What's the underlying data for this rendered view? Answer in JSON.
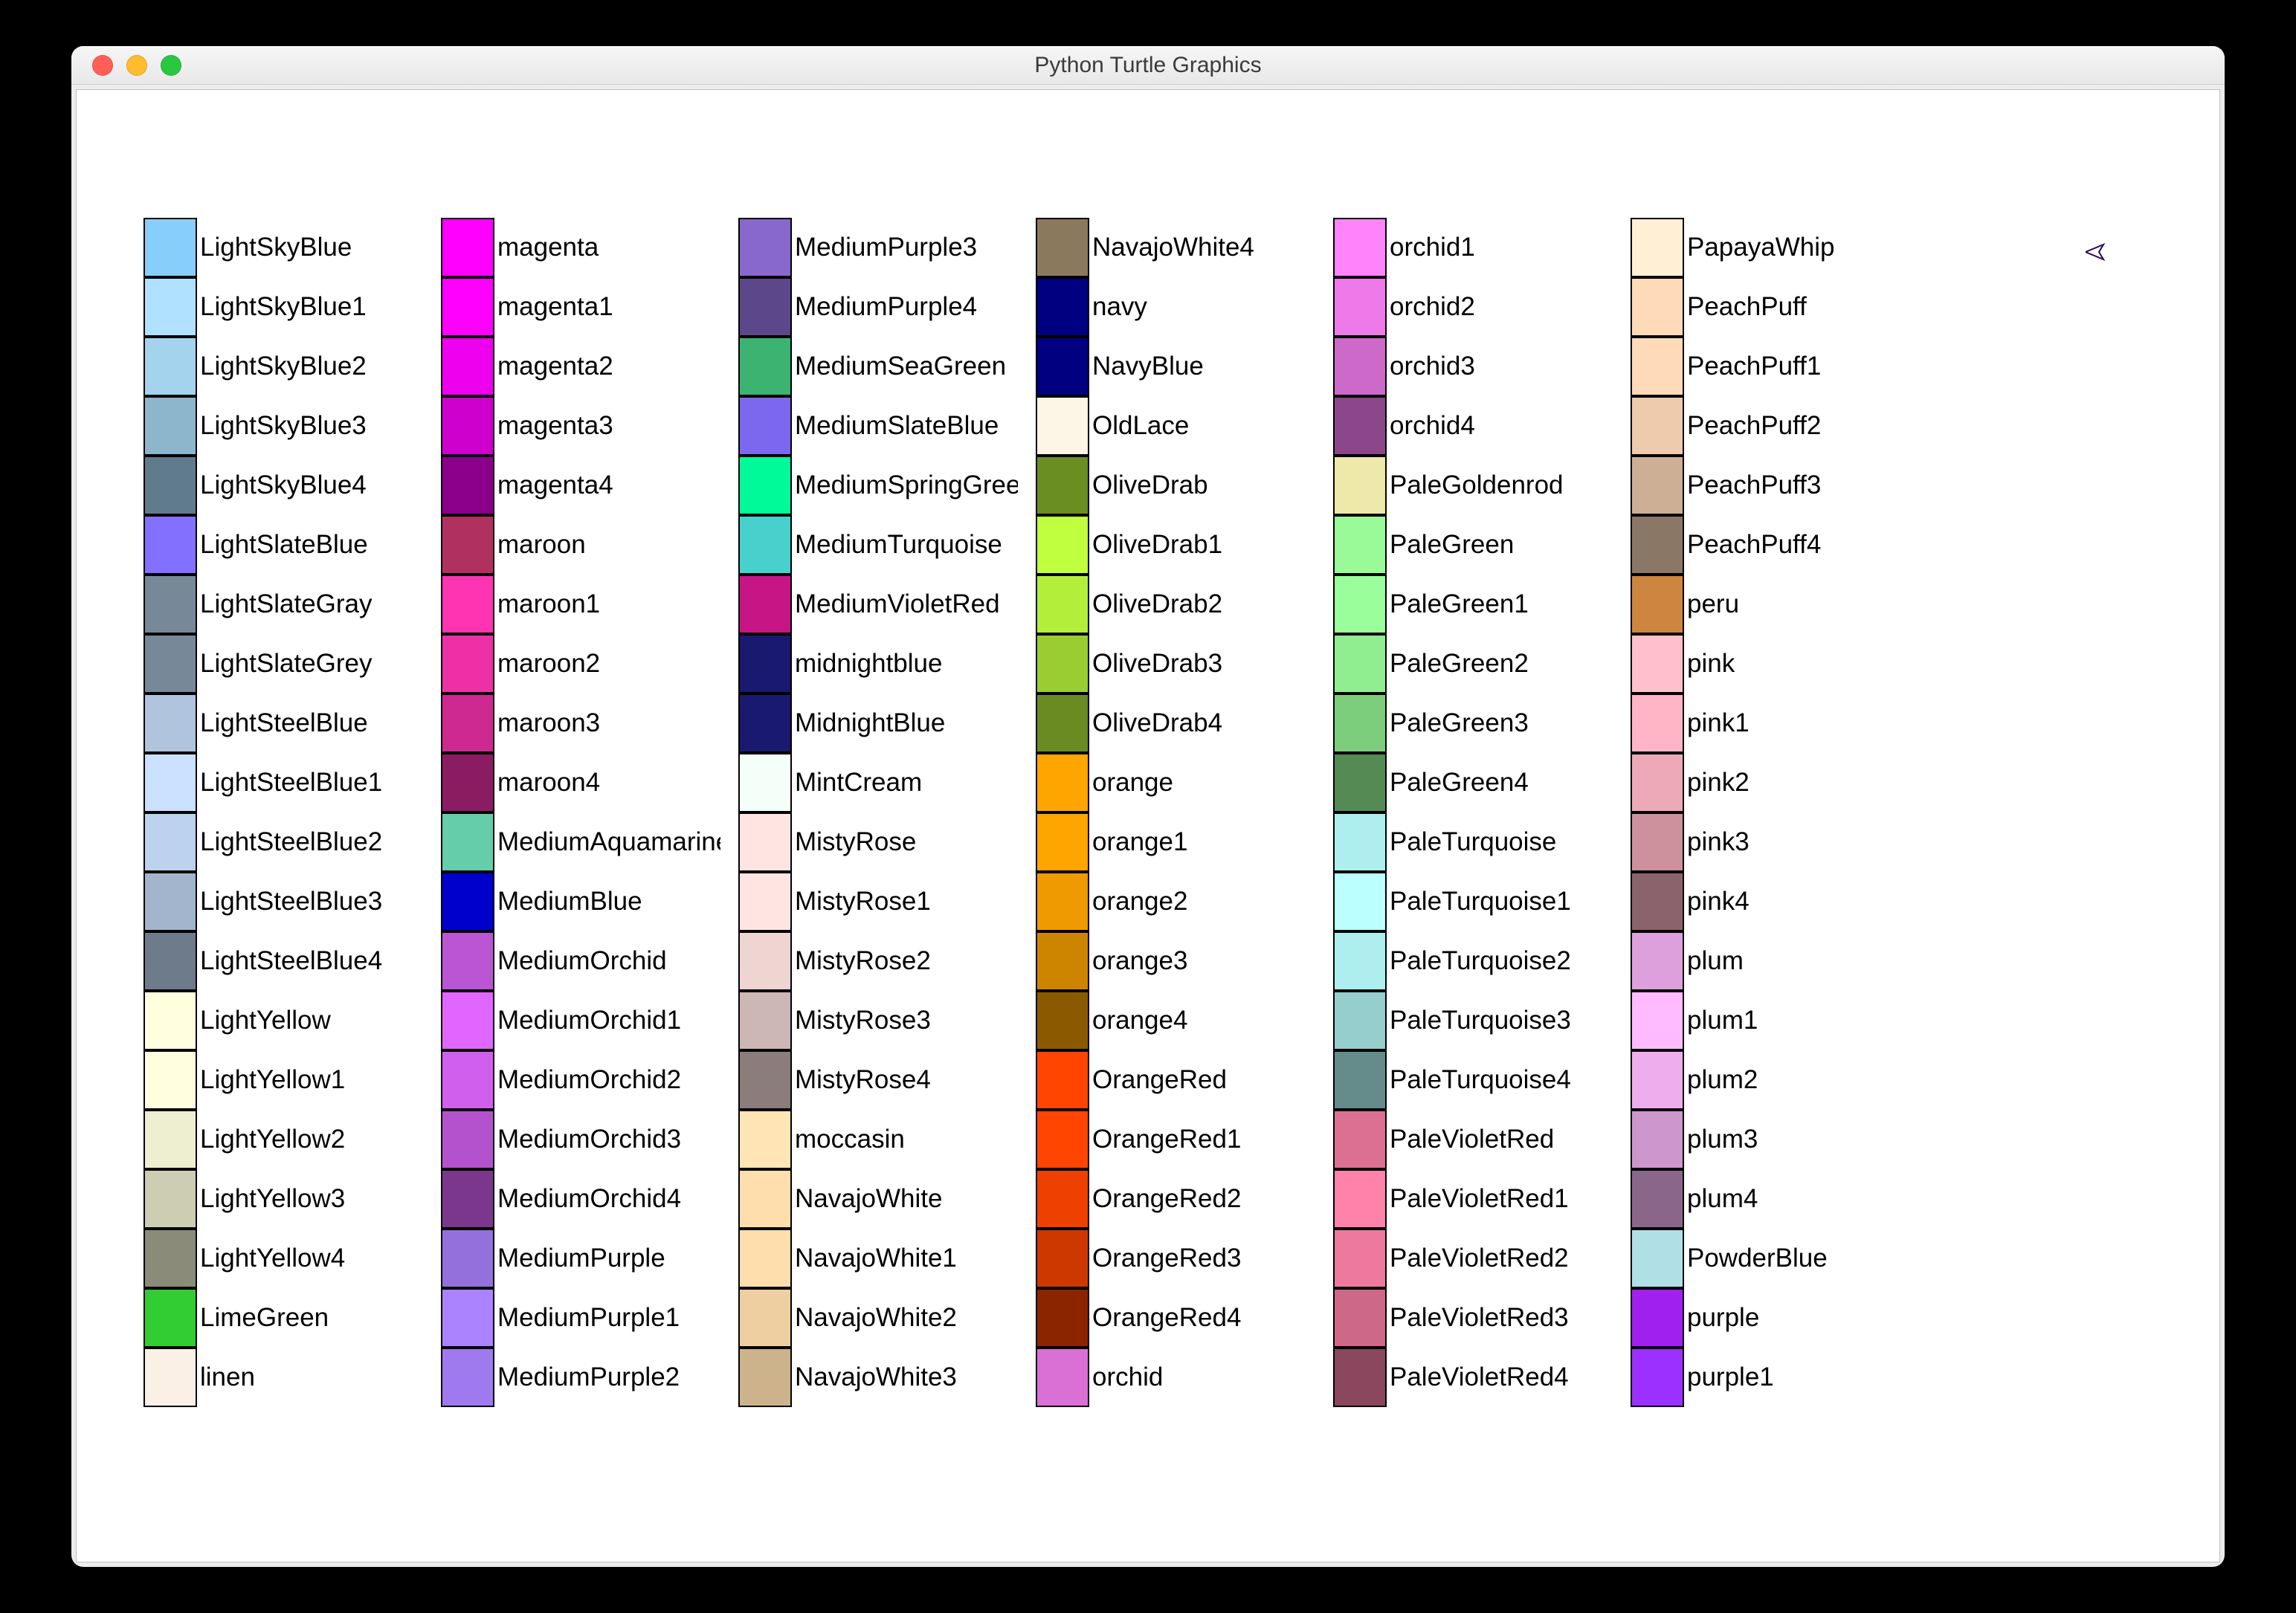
{
  "window_title": "Python Turtle Graphics",
  "columns": [
    [
      {
        "name": "LightSkyBlue",
        "hex": "#87CEFA"
      },
      {
        "name": "LightSkyBlue1",
        "hex": "#B0E2FF"
      },
      {
        "name": "LightSkyBlue2",
        "hex": "#A4D3EE"
      },
      {
        "name": "LightSkyBlue3",
        "hex": "#8DB6CD"
      },
      {
        "name": "LightSkyBlue4",
        "hex": "#607B8B"
      },
      {
        "name": "LightSlateBlue",
        "hex": "#8470FF"
      },
      {
        "name": "LightSlateGray",
        "hex": "#778899"
      },
      {
        "name": "LightSlateGrey",
        "hex": "#778899"
      },
      {
        "name": "LightSteelBlue",
        "hex": "#B0C4DE"
      },
      {
        "name": "LightSteelBlue1",
        "hex": "#CAE1FF"
      },
      {
        "name": "LightSteelBlue2",
        "hex": "#BCD2EE"
      },
      {
        "name": "LightSteelBlue3",
        "hex": "#A2B5CD"
      },
      {
        "name": "LightSteelBlue4",
        "hex": "#6E7B8B"
      },
      {
        "name": "LightYellow",
        "hex": "#FFFFE0"
      },
      {
        "name": "LightYellow1",
        "hex": "#FFFFE0"
      },
      {
        "name": "LightYellow2",
        "hex": "#EEEED1"
      },
      {
        "name": "LightYellow3",
        "hex": "#CDCDB4"
      },
      {
        "name": "LightYellow4",
        "hex": "#8B8B7A"
      },
      {
        "name": "LimeGreen",
        "hex": "#32CD32"
      },
      {
        "name": "linen",
        "hex": "#FAF0E6"
      }
    ],
    [
      {
        "name": "magenta",
        "hex": "#FF00FF"
      },
      {
        "name": "magenta1",
        "hex": "#FF00FF"
      },
      {
        "name": "magenta2",
        "hex": "#EE00EE"
      },
      {
        "name": "magenta3",
        "hex": "#CD00CD"
      },
      {
        "name": "magenta4",
        "hex": "#8B008B"
      },
      {
        "name": "maroon",
        "hex": "#B03060"
      },
      {
        "name": "maroon1",
        "hex": "#FF34B3"
      },
      {
        "name": "maroon2",
        "hex": "#EE30A7"
      },
      {
        "name": "maroon3",
        "hex": "#CD2990"
      },
      {
        "name": "maroon4",
        "hex": "#8B1C62"
      },
      {
        "name": "MediumAquamarine",
        "hex": "#66CDAA"
      },
      {
        "name": "MediumBlue",
        "hex": "#0000CD"
      },
      {
        "name": "MediumOrchid",
        "hex": "#BA55D3"
      },
      {
        "name": "MediumOrchid1",
        "hex": "#E066FF"
      },
      {
        "name": "MediumOrchid2",
        "hex": "#D15FEE"
      },
      {
        "name": "MediumOrchid3",
        "hex": "#B452CD"
      },
      {
        "name": "MediumOrchid4",
        "hex": "#7A378B"
      },
      {
        "name": "MediumPurple",
        "hex": "#9370DB"
      },
      {
        "name": "MediumPurple1",
        "hex": "#AB82FF"
      },
      {
        "name": "MediumPurple2",
        "hex": "#9F79EE"
      }
    ],
    [
      {
        "name": "MediumPurple3",
        "hex": "#8968CD"
      },
      {
        "name": "MediumPurple4",
        "hex": "#5D478B"
      },
      {
        "name": "MediumSeaGreen",
        "hex": "#3CB371"
      },
      {
        "name": "MediumSlateBlue",
        "hex": "#7B68EE"
      },
      {
        "name": "MediumSpringGreen",
        "hex": "#00FA9A"
      },
      {
        "name": "MediumTurquoise",
        "hex": "#48D1CC"
      },
      {
        "name": "MediumVioletRed",
        "hex": "#C71585"
      },
      {
        "name": "midnightblue",
        "hex": "#191970"
      },
      {
        "name": "MidnightBlue",
        "hex": "#191970"
      },
      {
        "name": "MintCream",
        "hex": "#F5FFFA"
      },
      {
        "name": "MistyRose",
        "hex": "#FFE4E1"
      },
      {
        "name": "MistyRose1",
        "hex": "#FFE4E1"
      },
      {
        "name": "MistyRose2",
        "hex": "#EED5D2"
      },
      {
        "name": "MistyRose3",
        "hex": "#CDB7B5"
      },
      {
        "name": "MistyRose4",
        "hex": "#8B7D7B"
      },
      {
        "name": "moccasin",
        "hex": "#FFE4B5"
      },
      {
        "name": "NavajoWhite",
        "hex": "#FFDEAD"
      },
      {
        "name": "NavajoWhite1",
        "hex": "#FFDEAD"
      },
      {
        "name": "NavajoWhite2",
        "hex": "#EECFA1"
      },
      {
        "name": "NavajoWhite3",
        "hex": "#CDB38B"
      }
    ],
    [
      {
        "name": "NavajoWhite4",
        "hex": "#8B795E"
      },
      {
        "name": "navy",
        "hex": "#000080"
      },
      {
        "name": "NavyBlue",
        "hex": "#000080"
      },
      {
        "name": "OldLace",
        "hex": "#FDF5E6"
      },
      {
        "name": "OliveDrab",
        "hex": "#6B8E23"
      },
      {
        "name": "OliveDrab1",
        "hex": "#C0FF3E"
      },
      {
        "name": "OliveDrab2",
        "hex": "#B3EE3A"
      },
      {
        "name": "OliveDrab3",
        "hex": "#9ACD32"
      },
      {
        "name": "OliveDrab4",
        "hex": "#698B22"
      },
      {
        "name": "orange",
        "hex": "#FFA500"
      },
      {
        "name": "orange1",
        "hex": "#FFA500"
      },
      {
        "name": "orange2",
        "hex": "#EE9A00"
      },
      {
        "name": "orange3",
        "hex": "#CD8500"
      },
      {
        "name": "orange4",
        "hex": "#8B5A00"
      },
      {
        "name": "OrangeRed",
        "hex": "#FF4500"
      },
      {
        "name": "OrangeRed1",
        "hex": "#FF4500"
      },
      {
        "name": "OrangeRed2",
        "hex": "#EE4000"
      },
      {
        "name": "OrangeRed3",
        "hex": "#CD3700"
      },
      {
        "name": "OrangeRed4",
        "hex": "#8B2500"
      },
      {
        "name": "orchid",
        "hex": "#DA70D6"
      }
    ],
    [
      {
        "name": "orchid1",
        "hex": "#FF83FA"
      },
      {
        "name": "orchid2",
        "hex": "#EE7AE9"
      },
      {
        "name": "orchid3",
        "hex": "#CD69C9"
      },
      {
        "name": "orchid4",
        "hex": "#8B4789"
      },
      {
        "name": "PaleGoldenrod",
        "hex": "#EEE8AA"
      },
      {
        "name": "PaleGreen",
        "hex": "#98FB98"
      },
      {
        "name": "PaleGreen1",
        "hex": "#9AFF9A"
      },
      {
        "name": "PaleGreen2",
        "hex": "#90EE90"
      },
      {
        "name": "PaleGreen3",
        "hex": "#7CCD7C"
      },
      {
        "name": "PaleGreen4",
        "hex": "#548B54"
      },
      {
        "name": "PaleTurquoise",
        "hex": "#AFEEEE"
      },
      {
        "name": "PaleTurquoise1",
        "hex": "#BBFFFF"
      },
      {
        "name": "PaleTurquoise2",
        "hex": "#AEEEEE"
      },
      {
        "name": "PaleTurquoise3",
        "hex": "#96CDCD"
      },
      {
        "name": "PaleTurquoise4",
        "hex": "#668B8B"
      },
      {
        "name": "PaleVioletRed",
        "hex": "#DB7093"
      },
      {
        "name": "PaleVioletRed1",
        "hex": "#FF82AB"
      },
      {
        "name": "PaleVioletRed2",
        "hex": "#EE799F"
      },
      {
        "name": "PaleVioletRed3",
        "hex": "#CD6889"
      },
      {
        "name": "PaleVioletRed4",
        "hex": "#8B475D"
      }
    ],
    [
      {
        "name": "PapayaWhip",
        "hex": "#FFEFD5"
      },
      {
        "name": "PeachPuff",
        "hex": "#FFDAB9"
      },
      {
        "name": "PeachPuff1",
        "hex": "#FFDAB9"
      },
      {
        "name": "PeachPuff2",
        "hex": "#EECBAD"
      },
      {
        "name": "PeachPuff3",
        "hex": "#CDAF95"
      },
      {
        "name": "PeachPuff4",
        "hex": "#8B7765"
      },
      {
        "name": "peru",
        "hex": "#CD853F"
      },
      {
        "name": "pink",
        "hex": "#FFC0CB"
      },
      {
        "name": "pink1",
        "hex": "#FFB5C5"
      },
      {
        "name": "pink2",
        "hex": "#EEA9B8"
      },
      {
        "name": "pink3",
        "hex": "#CD919E"
      },
      {
        "name": "pink4",
        "hex": "#8B636C"
      },
      {
        "name": "plum",
        "hex": "#DDA0DD"
      },
      {
        "name": "plum1",
        "hex": "#FFBBFF"
      },
      {
        "name": "plum2",
        "hex": "#EEAEEE"
      },
      {
        "name": "plum3",
        "hex": "#CD96CD"
      },
      {
        "name": "plum4",
        "hex": "#8B668B"
      },
      {
        "name": "PowderBlue",
        "hex": "#B0E0E6"
      },
      {
        "name": "purple",
        "hex": "#A020F0"
      },
      {
        "name": "purple1",
        "hex": "#9B30FF"
      }
    ]
  ]
}
